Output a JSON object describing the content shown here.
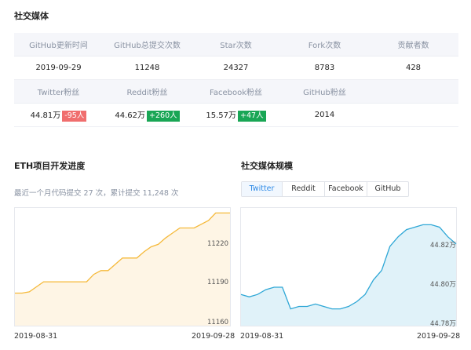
{
  "social_section": {
    "title": "社交媒体",
    "headers_row1": [
      "GitHub更新时间",
      "GitHub总提交次数",
      "Star次数",
      "Fork次数",
      "贡献者数"
    ],
    "values_row1": [
      "2019-09-29",
      "11248",
      "24327",
      "8783",
      "428"
    ],
    "headers_row2": [
      "Twitter粉丝",
      "Reddit粉丝",
      "Facebook粉丝",
      "GitHub粉丝"
    ],
    "values_row2": [
      {
        "value": "44.81万",
        "change": "-95人",
        "dir": "down"
      },
      {
        "value": "44.62万",
        "change": "+260人",
        "dir": "up"
      },
      {
        "value": "15.57万",
        "change": "+47人",
        "dir": "up"
      },
      {
        "value": "2014",
        "change": "",
        "dir": ""
      }
    ],
    "colors": {
      "down": "#f06e6e",
      "up": "#19a655"
    }
  },
  "dev_section": {
    "title": "ETH项目开发进度",
    "description": "最近一个月代码提交 27 次，累计提交 11,248 次"
  },
  "media_section": {
    "title": "社交媒体规模",
    "tabs": [
      "Twitter",
      "Reddit",
      "Facebook",
      "GitHub"
    ],
    "active_tab": "Twitter"
  },
  "chart_data": [
    {
      "type": "area",
      "color": "#f5b93a",
      "fill": "#fdf1dc",
      "y_ticks": [
        "11220",
        "11190",
        "11160"
      ],
      "y_tick_values": [
        11220,
        11190,
        11160
      ],
      "ylim": [
        11158,
        11252
      ],
      "x_labels": [
        "2019-08-31",
        "2019-09-28"
      ],
      "values": [
        11184,
        11184,
        11185,
        11189,
        11193,
        11193,
        11193,
        11193,
        11193,
        11193,
        11193,
        11199,
        11202,
        11202,
        11207,
        11212,
        11212,
        11212,
        11217,
        11221,
        11223,
        11228,
        11232,
        11236,
        11236,
        11236,
        11239,
        11242,
        11248,
        11248,
        11248
      ]
    },
    {
      "type": "area",
      "color": "#2ea7d6",
      "fill": "#d6edf7",
      "y_ticks": [
        "44.82万",
        "44.80万",
        "44.78万"
      ],
      "y_tick_values": [
        44.82,
        44.8,
        44.78
      ],
      "ylim": [
        44.777,
        44.826
      ],
      "x_labels": [
        "2019-08-31",
        "2019-09-28"
      ],
      "values": [
        44.79,
        44.789,
        44.79,
        44.792,
        44.793,
        44.793,
        44.784,
        44.785,
        44.785,
        44.786,
        44.785,
        44.784,
        44.784,
        44.785,
        44.787,
        44.79,
        44.796,
        44.8,
        44.81,
        44.814,
        44.817,
        44.818,
        44.819,
        44.819,
        44.818,
        44.814,
        44.811
      ]
    }
  ]
}
